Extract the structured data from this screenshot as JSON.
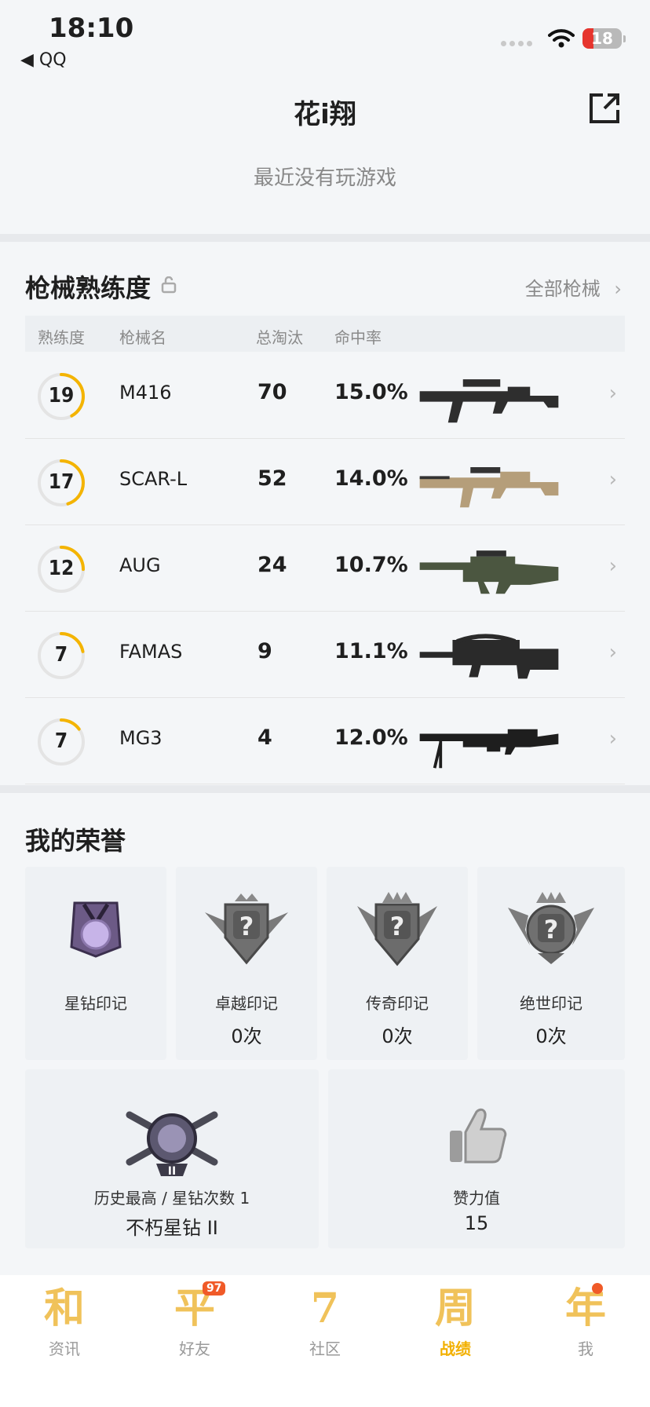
{
  "status_bar": {
    "time": "18:10",
    "back_label": "◀ QQ",
    "battery": "18"
  },
  "header": {
    "title": "花i翔",
    "status": "最近没有玩游戏"
  },
  "weapons": {
    "title": "枪械熟练度",
    "all_label": "全部枪械",
    "columns": [
      "熟练度",
      "枪械名",
      "总淘汰",
      "命中率"
    ],
    "rows": [
      {
        "level": "19",
        "progress": 0.42,
        "name": "M416",
        "kills": "70",
        "hit_rate": "15.0%",
        "gun_icon": "rifle-m416"
      },
      {
        "level": "17",
        "progress": 0.45,
        "name": "SCAR-L",
        "kills": "52",
        "hit_rate": "14.0%",
        "gun_icon": "rifle-scar-l"
      },
      {
        "level": "12",
        "progress": 0.25,
        "name": "AUG",
        "kills": "24",
        "hit_rate": "10.7%",
        "gun_icon": "rifle-aug"
      },
      {
        "level": "7",
        "progress": 0.22,
        "name": "FAMAS",
        "kills": "9",
        "hit_rate": "11.1%",
        "gun_icon": "rifle-famas"
      },
      {
        "level": "7",
        "progress": 0.15,
        "name": "MG3",
        "kills": "4",
        "hit_rate": "12.0%",
        "gun_icon": "lmg-mg3"
      }
    ]
  },
  "honors": {
    "title": "我的荣誉",
    "cards": [
      {
        "label": "星钻印记",
        "count": "",
        "icon": "star-diamond-medal-icon"
      },
      {
        "label": "卓越印记",
        "count": "0次",
        "icon": "excellence-badge-icon"
      },
      {
        "label": "传奇印记",
        "count": "0次",
        "icon": "legend-badge-icon"
      },
      {
        "label": "绝世印记",
        "count": "0次",
        "icon": "peerless-badge-icon"
      }
    ],
    "best": {
      "label": "历史最高 / 星钻次数 1",
      "value": "不朽星钻 II",
      "icon": "rank-badge-icon"
    },
    "likes": {
      "label": "赞力值",
      "value": "15",
      "icon": "thumbs-up-icon"
    }
  },
  "nav": {
    "items": [
      {
        "glyph": "和",
        "label": "资讯"
      },
      {
        "glyph": "平",
        "label": "好友",
        "badge": "97"
      },
      {
        "glyph": "7",
        "label": "社区"
      },
      {
        "glyph": "周",
        "label": "战绩"
      },
      {
        "glyph": "年",
        "label": "我"
      }
    ]
  },
  "colors": {
    "accent": "#f2b000",
    "badge": "#f05a28",
    "background": "#f4f6f8"
  }
}
